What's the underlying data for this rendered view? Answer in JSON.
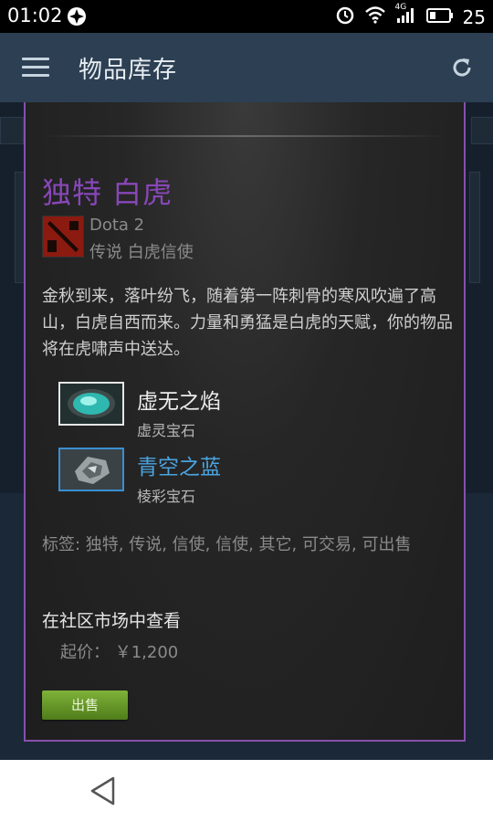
{
  "status_bar": {
    "time": "01:02",
    "battery": "25",
    "network": "4G",
    "icons": [
      "app-status-icon",
      "alarm-icon",
      "wifi-icon",
      "signal-icon",
      "battery-icon"
    ]
  },
  "header": {
    "title": "物品库存",
    "menu_icon": "hamburger-menu-icon",
    "refresh_icon": "refresh-icon"
  },
  "item": {
    "name": "独特 白虎",
    "name_color": "#8847b8",
    "game": "Dota 2",
    "type": "传说 白虎信使",
    "description": "金秋到来，落叶纷飞，随着第一阵刺骨的寒风吹遍了高山，白虎自西而来。力量和勇猛是白虎的天赋，你的物品将在虎啸声中送达。",
    "gems": [
      {
        "name": "虚无之焰",
        "type": "虚灵宝石",
        "color": "#ececec"
      },
      {
        "name": "青空之蓝",
        "type": "棱彩宝石",
        "color": "#4aa3df"
      }
    ],
    "tags": "标签: 独特, 传说, 信使, 信使, 其它, 可交易, 可出售"
  },
  "market": {
    "link_label": "在社区市场中查看",
    "price_label": "起价：",
    "price_value": "￥1,200"
  },
  "actions": {
    "sell_label": "出售"
  },
  "colors": {
    "accent_border": "#8650ac",
    "sell_button": "#6a9a2a",
    "app_bar": "#2d3f52"
  }
}
